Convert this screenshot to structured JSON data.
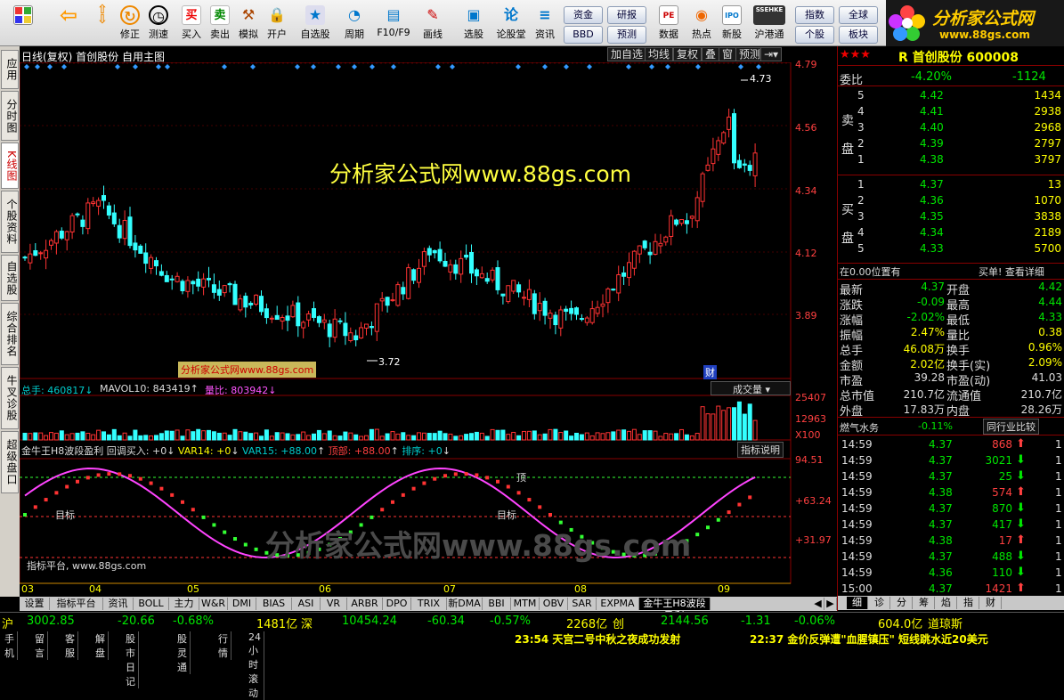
{
  "toolbar": {
    "buttons": [
      "",
      "",
      "修正",
      "测速",
      "买入",
      "卖出",
      "模拟",
      "开户",
      "自选股",
      "周期",
      "F10/F9",
      "画线",
      "选股",
      "论股堂",
      "资讯",
      "",
      "",
      "数据",
      "热点",
      "新股",
      "沪港通",
      "",
      ""
    ],
    "small": [
      "资金",
      "BBD",
      "研报",
      "预测",
      "指数",
      "个股",
      "全球",
      "板块"
    ],
    "badges": [
      "PE",
      "SSEHKE",
      "IPO"
    ]
  },
  "logo": {
    "title": "分析家公式网",
    "url": "www.88gs.com"
  },
  "sidebar": [
    "应用",
    "分时图",
    "K线图",
    "个股资料",
    "自选股",
    "综合排名",
    "牛叉诊股",
    "超级盘口"
  ],
  "chart_header": {
    "text": "日线(复权) 首创股份 自用主图",
    "buttons": [
      "加自选",
      "均线",
      "复权",
      "叠",
      "窗",
      "预测"
    ]
  },
  "watermark": "分析家公式网www.88gs.com",
  "watermark2": "分析家公式网www.88gs.com",
  "tag": "分析家公式网www.88gs.com",
  "price_axis": [
    "4.79",
    "4.56",
    "4.34",
    "4.12",
    "3.89"
  ],
  "hi_label": "4.73",
  "lo_label": "3.72",
  "cai": "财",
  "volume": {
    "label1": "总手: 460817",
    "label2": "MAVOL10: 843419",
    "label3": "量比: 803942",
    "dropdown": "成交量",
    "axis": [
      "25407",
      "12963",
      "X100"
    ]
  },
  "indicator": {
    "title": "金牛王H8波段盈利",
    "items": [
      "回调买入: +0",
      "VAR14: +0",
      "VAR15: +88.00",
      "顶部: +88.00",
      "排序: +0"
    ],
    "explain": "指标说明",
    "axis": [
      "94.51",
      "+63.24",
      "+31.97"
    ],
    "target": "目标",
    "top": "顶",
    "platform": "指标平台, www.88gs.com"
  },
  "dates": [
    "03",
    "04",
    "05",
    "06",
    "07",
    "08",
    "09"
  ],
  "tabs": [
    "设置",
    "指标平台",
    "资讯",
    "BOLL",
    "主力",
    "W&R",
    "DMI",
    "BIAS",
    "ASI",
    "VR",
    "ARBR",
    "DPO",
    "TRIX",
    "新DMA",
    "BBI",
    "MTM",
    "OBV",
    "SAR",
    "EXPMA",
    "金牛王H8波段盈利"
  ],
  "right": {
    "title": "R 首创股份 600008",
    "webi_label": "委比",
    "webi": "-4.20%",
    "webi_n": "-1124",
    "sell_label": "卖盘",
    "buy_label": "买盘",
    "sell": [
      [
        "5",
        "4.42",
        "1434"
      ],
      [
        "4",
        "4.41",
        "2938"
      ],
      [
        "3",
        "4.40",
        "2968"
      ],
      [
        "2",
        "4.39",
        "2797"
      ],
      [
        "1",
        "4.38",
        "3797"
      ]
    ],
    "buy": [
      [
        "1",
        "4.37",
        "13"
      ],
      [
        "2",
        "4.36",
        "1070"
      ],
      [
        "3",
        "4.35",
        "3838"
      ],
      [
        "4",
        "4.34",
        "2189"
      ],
      [
        "5",
        "4.33",
        "5700"
      ]
    ],
    "pos_text": "在0.00位置有",
    "pos_right": "买单! 查看详细",
    "quotes": [
      [
        "最新",
        "4.37",
        "开盘",
        "4.42"
      ],
      [
        "涨跌",
        "-0.09",
        "最高",
        "4.44"
      ],
      [
        "涨幅",
        "-2.02%",
        "最低",
        "4.33"
      ],
      [
        "振幅",
        "2.47%",
        "量比",
        "0.38"
      ],
      [
        "总手",
        "46.08万",
        "换手",
        "0.96%"
      ],
      [
        "金额",
        "2.02亿",
        "换手(实)",
        "2.09%"
      ],
      [
        "市盈",
        "39.28",
        "市盈(动)",
        "41.03"
      ],
      [
        "总市值",
        "210.7亿",
        "流通值",
        "210.7亿"
      ],
      [
        "外盘",
        "17.83万",
        "内盘",
        "28.26万"
      ]
    ],
    "industry": "燃气水务",
    "industry_pct": "-0.11%",
    "industry_btn": "同行业比较",
    "ticks": [
      [
        "14:59",
        "4.37",
        "868"
      ],
      [
        "14:59",
        "4.37",
        "3021"
      ],
      [
        "14:59",
        "4.37",
        "25"
      ],
      [
        "14:59",
        "4.38",
        "574"
      ],
      [
        "14:59",
        "4.37",
        "870"
      ],
      [
        "14:59",
        "4.37",
        "417"
      ],
      [
        "14:59",
        "4.38",
        "17"
      ],
      [
        "14:59",
        "4.37",
        "488"
      ],
      [
        "14:59",
        "4.36",
        "110"
      ],
      [
        "15:00",
        "4.37",
        "1421"
      ]
    ],
    "tick_last": "1",
    "bottom_tabs": [
      "细",
      "诊",
      "分",
      "筹",
      "焰",
      "指",
      "财"
    ]
  },
  "status": {
    "sh_label": "沪",
    "sh": "3002.85",
    "sh_chg": "-20.66",
    "sh_pct": "-0.68%",
    "sh_amt": "1481亿",
    "sz_label": "深",
    "sz": "10454.24",
    "sz_chg": "-60.34",
    "sz_pct": "-0.57%",
    "sz_amt": "2268亿",
    "cy_label": "创",
    "cy": "2144.56",
    "cy_chg": "-1.31",
    "cy_pct": "-0.06%",
    "cy_amt": "604.0亿",
    "dj": "道琼斯"
  },
  "bottom": {
    "links": [
      "手机",
      "留言",
      "客服",
      "解盘",
      "股市日记",
      "股灵通",
      "行情",
      "24小时滚动"
    ],
    "news1": "23:54 天宫二号中秋之夜成功发射",
    "news2": "22:37 金价反弹遭\"血腥镇压\" 短线跳水近20美元"
  }
}
